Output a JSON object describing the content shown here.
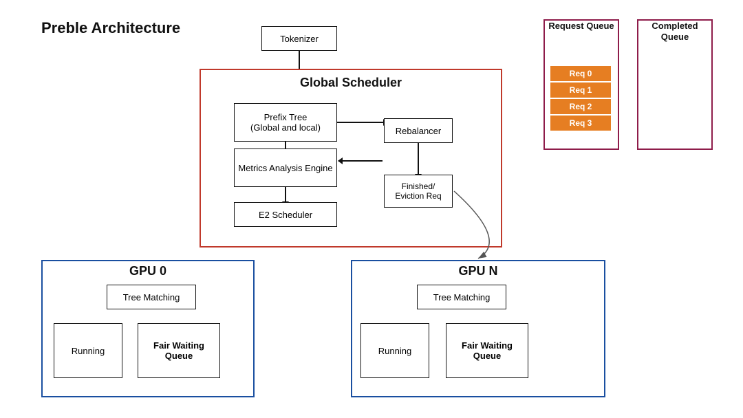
{
  "title": "Preble Architecture",
  "tokenizer": {
    "label": "Tokenizer"
  },
  "global_scheduler": {
    "title": "Global Scheduler",
    "prefix_tree": {
      "label": "Prefix Tree\n(Global and local)"
    },
    "rebalancer": {
      "label": "Rebalancer"
    },
    "metrics_engine": {
      "label": "Metrics Analysis Engine"
    },
    "e2_scheduler": {
      "label": "E2 Scheduler"
    },
    "finished_eviction": {
      "label": "Finished/\nEviction Req"
    }
  },
  "request_queue": {
    "title": "Request\nQueue",
    "items": [
      "Req 0",
      "Req 1",
      "Req 2",
      "Req 3"
    ]
  },
  "completed_queue": {
    "title": "Completed\nQueue"
  },
  "gpu0": {
    "title": "GPU 0",
    "tree_matching": "Tree Matching",
    "running": "Running",
    "fair_waiting_queue": "Fair Waiting\nQueue"
  },
  "gpun": {
    "title": "GPU N",
    "tree_matching": "Tree Matching",
    "running": "Running",
    "fair_waiting_queue": "Fair Waiting\nQueue"
  }
}
